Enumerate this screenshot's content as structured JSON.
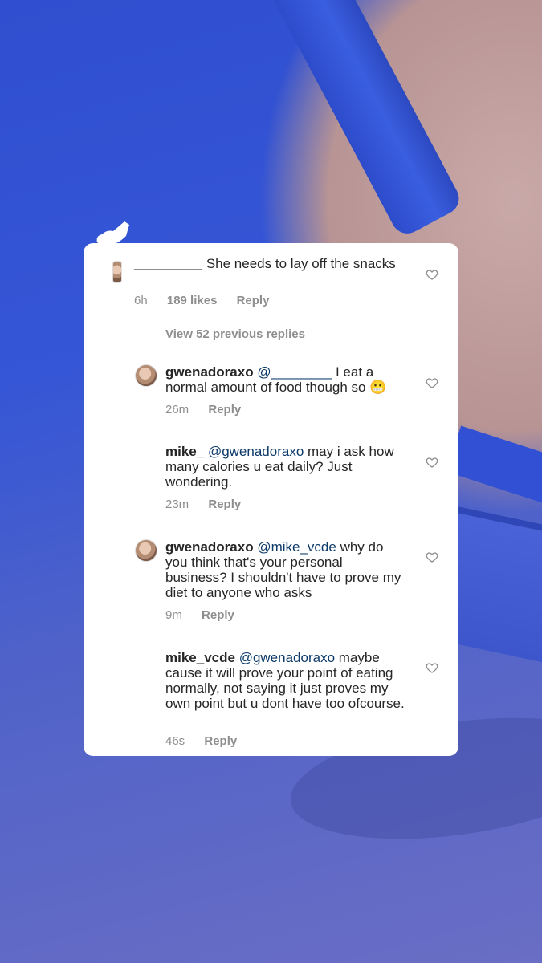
{
  "comments": [
    {
      "username": "_________",
      "text": "She needs to lay off the snacks",
      "time": "6h",
      "likes": "189 likes",
      "reply_label": "Reply"
    },
    {
      "username": "gwenadoraxo",
      "mention": "@________",
      "text": "I eat a normal amount of food though so 😬",
      "time": "26m",
      "reply_label": "Reply"
    },
    {
      "username": "mike_",
      "mention": "@gwenadoraxo",
      "text": "may i ask how many calories u eat daily? Just wondering.",
      "time": "23m",
      "reply_label": "Reply"
    },
    {
      "username": "gwenadoraxo",
      "mention": "@mike_vcde",
      "text": "why do you think that's your personal business? I shouldn't have to prove my diet to anyone who asks",
      "time": "9m",
      "reply_label": "Reply"
    },
    {
      "username": "mike_vcde",
      "mention": "@gwenadoraxo",
      "text": "maybe cause it will prove your point of eating normally, not saying it just proves my own point but u dont have too ofcourse.",
      "time": "46s",
      "reply_label": "Reply"
    }
  ],
  "view_previous": "View 52 previous replies",
  "icons": {
    "like": "heart-outline-icon",
    "avatar": "profile-avatar"
  },
  "colors": {
    "mention": "#0d3a69",
    "meta": "#8e8e8e",
    "text": "#262626",
    "card": "#ffffff"
  }
}
